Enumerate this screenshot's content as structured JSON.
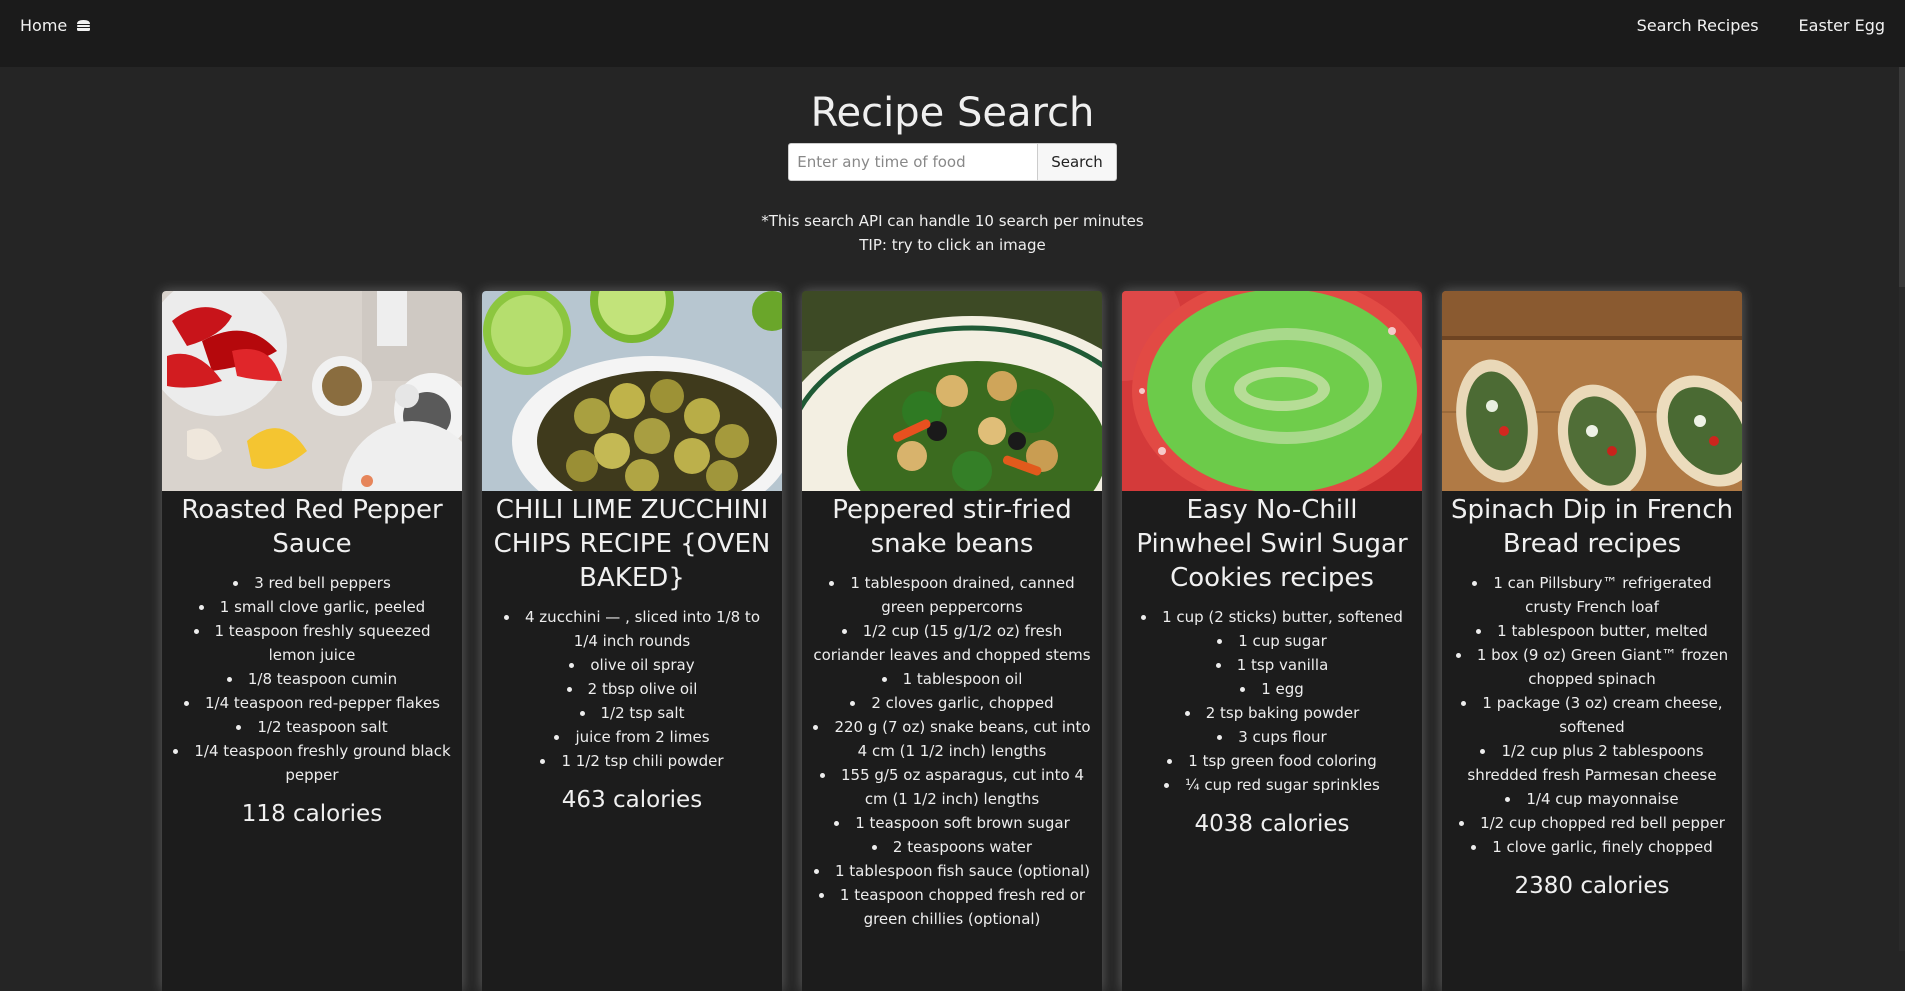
{
  "nav": {
    "home_label": "Home",
    "home_icon": "hamburger-icon",
    "search_recipes_label": "Search Recipes",
    "easter_egg_label": "Easter Egg"
  },
  "header": {
    "title": "Recipe Search",
    "search_placeholder": "Enter any time of food",
    "search_button_label": "Search",
    "note_api": "*This search API can handle 10 search per minutes",
    "note_tip": "TIP: try to click an image"
  },
  "recipes": [
    {
      "title": "Roasted Red Pepper Sauce",
      "ingredients": [
        "3 red bell peppers",
        "1 small clove garlic, peeled",
        "1 teaspoon freshly squeezed lemon juice",
        "1/8 teaspoon cumin",
        "1/4 teaspoon red-pepper flakes",
        "1/2 teaspoon salt",
        "1/4 teaspoon freshly ground black pepper"
      ],
      "calories": "118 calories"
    },
    {
      "title": "CHILI LIME ZUCCHINI CHIPS RECIPE {OVEN BAKED}",
      "ingredients": [
        "4 zucchini — , sliced into 1/8 to 1/4 inch rounds",
        "olive oil spray",
        "2 tbsp olive oil",
        "1/2 tsp salt",
        "juice from 2 limes",
        "1 1/2 tsp chili powder"
      ],
      "calories": "463 calories"
    },
    {
      "title": "Peppered stir-fried snake beans",
      "ingredients": [
        "1 tablespoon drained, canned green peppercorns",
        "1/2 cup (15 g/1/2 oz) fresh coriander leaves and chopped stems",
        "1 tablespoon oil",
        "2 cloves garlic, chopped",
        "220 g (7 oz) snake beans, cut into 4 cm (1 1/2 inch) lengths",
        "155 g/5 oz asparagus, cut into 4 cm (1 1/2 inch) lengths",
        "1 teaspoon soft brown sugar",
        "2 teaspoons water",
        "1 tablespoon fish sauce (optional)",
        "1 teaspoon chopped fresh red or green chillies (optional)"
      ],
      "calories": ""
    },
    {
      "title": "Easy No-Chill Pinwheel Swirl Sugar Cookies recipes",
      "ingredients": [
        "1 cup (2 sticks) butter, softened",
        "1 cup sugar",
        "1 tsp vanilla",
        "1 egg",
        "2 tsp baking powder",
        "3 cups flour",
        "1 tsp green food coloring",
        "¼ cup red sugar sprinkles"
      ],
      "calories": "4038 calories"
    },
    {
      "title": "Spinach Dip in French Bread recipes",
      "ingredients": [
        "1 can Pillsbury™ refrigerated crusty French loaf",
        "1 tablespoon butter, melted",
        "1 box (9 oz) Green Giant™ frozen chopped spinach",
        "1 package (3 oz) cream cheese, softened",
        "1/2 cup plus 2 tablespoons shredded fresh Parmesan cheese",
        "1/4 cup mayonnaise",
        "1/2 cup chopped red bell pepper",
        "1 clove garlic, finely chopped"
      ],
      "calories": "2380 calories"
    }
  ]
}
